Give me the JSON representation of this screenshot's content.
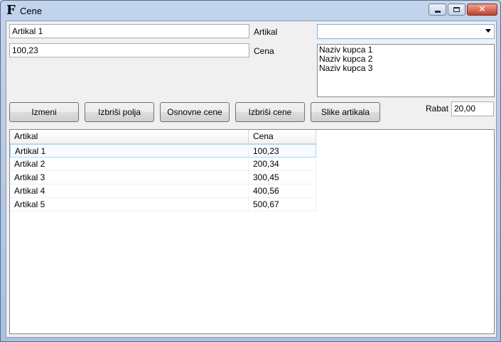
{
  "window": {
    "icon_letter": "F",
    "title": "Cene",
    "close_glyph": "✕"
  },
  "form": {
    "article_value": "Artikal 1",
    "price_value": "100,23",
    "article_label": "Artikal",
    "price_label": "Cena",
    "combo_value": "",
    "customers": [
      "Naziv kupca 1",
      "Naziv kupca 2",
      "Naziv kupca 3"
    ],
    "discount_label": "Rabat",
    "discount_value": "20,00"
  },
  "buttons": {
    "edit": "Izmeni",
    "clear_fields": "Izbriši polja",
    "base_prices": "Osnovne cene",
    "delete_prices": "Izbriši cene",
    "article_images": "Slike artikala"
  },
  "grid": {
    "columns": [
      "Artikal",
      "Cena"
    ],
    "rows": [
      {
        "artikal": "Artikal 1",
        "cena": "100,23"
      },
      {
        "artikal": "Artikal 2",
        "cena": "200,34"
      },
      {
        "artikal": "Artikal 3",
        "cena": "300,45"
      },
      {
        "artikal": "Artikal 4",
        "cena": "400,56"
      },
      {
        "artikal": "Artikal 5",
        "cena": "500,67"
      }
    ],
    "selected_row": 0
  },
  "colors": {
    "selection_border": "#a8d8f5",
    "close_button": "#c3402a"
  }
}
